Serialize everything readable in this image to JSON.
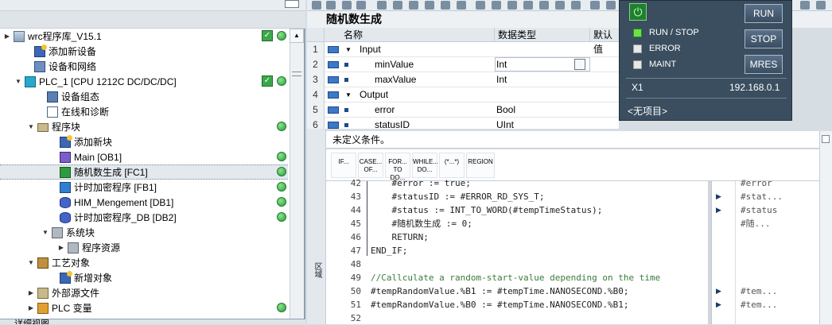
{
  "project_tree": {
    "items": [
      {
        "label": "wrc程序库_V15.1",
        "expander": "▶",
        "icon": "library-icon",
        "check": true,
        "dot": true
      },
      {
        "label": "添加新设备",
        "expander": "",
        "icon": "add-device-icon"
      },
      {
        "label": "设备和网络",
        "expander": "",
        "icon": "network-icon"
      },
      {
        "label": "PLC_1 [CPU 1212C DC/DC/DC]",
        "expander": "▼",
        "icon": "plc-icon",
        "check": true,
        "dot": true
      },
      {
        "label": "设备组态",
        "expander": "",
        "icon": "device-config-icon"
      },
      {
        "label": "在线和诊断",
        "expander": "",
        "icon": "diagnostics-icon"
      },
      {
        "label": "程序块",
        "expander": "▼",
        "icon": "folder-icon",
        "dot": true
      },
      {
        "label": "添加新块",
        "expander": "",
        "icon": "add-block-icon"
      },
      {
        "label": "Main [OB1]",
        "expander": "",
        "icon": "ob-block-icon",
        "dot": true
      },
      {
        "label": "随机数生成 [FC1]",
        "expander": "",
        "icon": "fc-block-icon",
        "dot": true,
        "selected": true
      },
      {
        "label": "计时加密程序 [FB1]",
        "expander": "",
        "icon": "fb-block-icon",
        "dot": true
      },
      {
        "label": "HIM_Mengement [DB1]",
        "expander": "",
        "icon": "db-block-icon",
        "dot": true
      },
      {
        "label": "计时加密程序_DB [DB2]",
        "expander": "",
        "icon": "db-block-icon",
        "dot": true
      },
      {
        "label": "系统块",
        "expander": "▼",
        "icon": "system-block-icon"
      },
      {
        "label": "程序资源",
        "expander": "▶",
        "icon": "program-resource-icon"
      },
      {
        "label": "工艺对象",
        "expander": "▼",
        "icon": "technology-object-icon"
      },
      {
        "label": "新增对象",
        "expander": "",
        "icon": "add-object-icon"
      },
      {
        "label": "外部源文件",
        "expander": "▶",
        "icon": "external-source-icon"
      },
      {
        "label": "PLC 变量",
        "expander": "▶",
        "icon": "plc-tag-icon",
        "dot": true
      }
    ],
    "bottom_label": "详细视图"
  },
  "editor": {
    "block_title": "随机数生成",
    "interface": {
      "headers": {
        "name": "名称",
        "datatype": "数据类型",
        "default": "默认值"
      },
      "rows": [
        {
          "num": "1",
          "name": "Input",
          "type": "",
          "section": true
        },
        {
          "num": "2",
          "name": "minValue",
          "type": "Int"
        },
        {
          "num": "3",
          "name": "maxValue",
          "type": "Int"
        },
        {
          "num": "4",
          "name": "Output",
          "type": "",
          "section": true
        },
        {
          "num": "5",
          "name": "error",
          "type": "Bool"
        },
        {
          "num": "6",
          "name": "statusID",
          "type": "UInt"
        }
      ]
    },
    "condition_text": "未定义条件。",
    "instructions": [
      "IF...",
      "CASE... OF...",
      "FOR... TO DO...",
      "WHILE... DO...",
      "(*...*)",
      "REGION"
    ],
    "left_rail_label": "区域",
    "code_lines": [
      {
        "num": "42",
        "text": "    #error := true;",
        "right": "#error",
        "mark": false
      },
      {
        "num": "43",
        "text": "    #statusID := #ERROR_RD_SYS_T;",
        "right": "#stat...",
        "mark": true
      },
      {
        "num": "44",
        "text": "    #status := INT_TO_WORD(#tempTimeStatus);",
        "right": "#status",
        "mark": true
      },
      {
        "num": "45",
        "text": "    #随机数生成 := 0;",
        "right": "#随...",
        "mark": false
      },
      {
        "num": "46",
        "text": "    RETURN;",
        "right": "",
        "mark": false
      },
      {
        "num": "47",
        "text": "END_IF;",
        "right": "",
        "mark": false
      },
      {
        "num": "48",
        "text": "",
        "right": "",
        "mark": false
      },
      {
        "num": "49",
        "text": "//Callculate a random-start-value depending on the time",
        "right": "",
        "mark": false,
        "comment": true
      },
      {
        "num": "50",
        "text": "#tempRandomValue.%B1 := #tempTime.NANOSECOND.%B0;",
        "right": "#tem...",
        "mark": true
      },
      {
        "num": "51",
        "text": "#tempRandomValue.%B0 := #tempTime.NANOSECOND.%B1;",
        "right": "#tem...",
        "mark": true
      },
      {
        "num": "52",
        "text": "",
        "right": "",
        "mark": false
      }
    ]
  },
  "online_panel": {
    "run_stop_label": "RUN / STOP",
    "error_label": "ERROR",
    "maint_label": "MAINT",
    "run_button": "RUN",
    "stop_button": "STOP",
    "mres_button": "MRES",
    "port": "X1",
    "ip": "192.168.0.1",
    "project_label": "<无项目>"
  }
}
